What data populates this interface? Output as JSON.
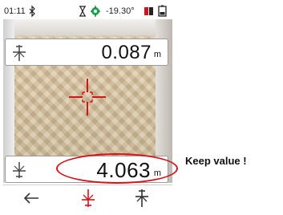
{
  "status_bar": {
    "time": "01:11",
    "bluetooth_icon": "bluetooth-icon",
    "timer_icon": "hourglass-icon",
    "gps_icon": "gps-target-icon",
    "tilt": "-19.30°",
    "laser_icon": "laser-level-icon",
    "battery_icon": "battery-icon"
  },
  "measurements": {
    "top": {
      "value": "0.087",
      "unit": "m",
      "icon": "reference-front-icon"
    },
    "bottom": {
      "value": "4.063",
      "unit": "m",
      "icon": "reference-rear-icon"
    }
  },
  "crosshair": {
    "icon": "target-crosshair-icon",
    "color": "#d4141a"
  },
  "toolbar": {
    "buttons": [
      {
        "icon": "back-arrow-icon"
      },
      {
        "icon": "reference-rear-icon",
        "color": "#d4141a"
      },
      {
        "icon": "reference-front-icon"
      }
    ]
  },
  "annotation": {
    "text": "Keep value !",
    "highlight_color": "#d4141a"
  }
}
